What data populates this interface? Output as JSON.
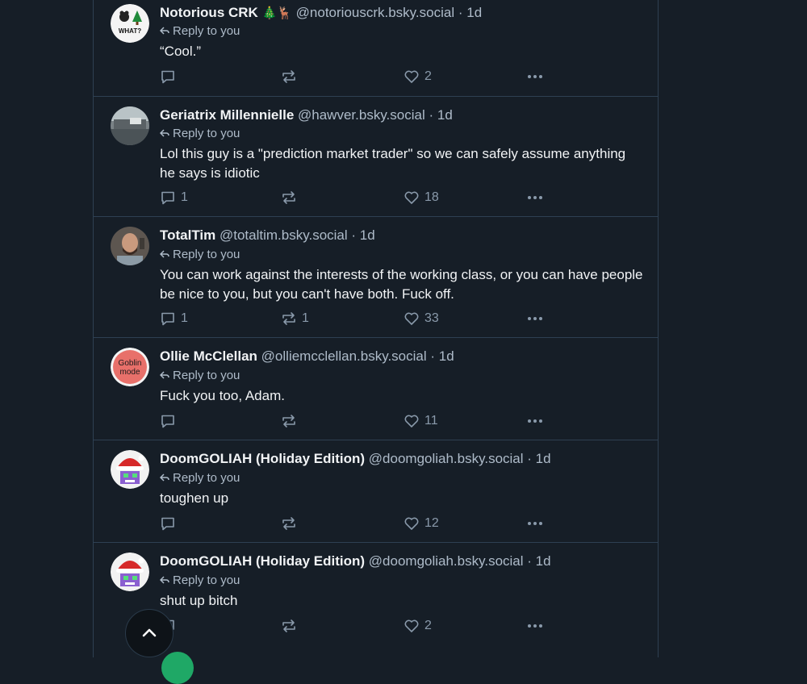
{
  "posts": [
    {
      "name": "Notorious CRK",
      "emoji": "🎄🦌",
      "handle": "@notoriouscrk.bsky.social",
      "time": "1d",
      "reply_label": "Reply to you",
      "text": "“Cool.”",
      "replies": "",
      "reposts": "",
      "likes": "2",
      "avatar": "what-avatar",
      "avatar_text": "WHAT?"
    },
    {
      "name": "Geriatrix Millennielle",
      "emoji": "",
      "handle": "@hawver.bsky.social",
      "time": "1d",
      "reply_label": "Reply to you",
      "text": "Lol this guy is a \"prediction market trader\" so we can safely assume anything he says is idiotic",
      "replies": "1",
      "reposts": "",
      "likes": "18",
      "avatar": "photo-avatar"
    },
    {
      "name": "TotalTim",
      "emoji": "",
      "handle": "@totaltim.bsky.social",
      "time": "1d",
      "reply_label": "Reply to you",
      "text": "You can work against the interests of the working class, or you can have people be nice to you, but you can't have both. Fuck off.",
      "replies": "1",
      "reposts": "1",
      "likes": "33",
      "avatar": "person-avatar"
    },
    {
      "name": "Ollie McClellan",
      "emoji": "",
      "handle": "@olliemcclellan.bsky.social",
      "time": "1d",
      "reply_label": "Reply to you",
      "text": "Fuck you too, Adam.",
      "replies": "",
      "reposts": "",
      "likes": "11",
      "avatar": "goblin-avatar",
      "avatar_text": "Goblin mode"
    },
    {
      "name": "DoomGOLIAH (Holiday Edition)",
      "emoji": "",
      "handle": "@doomgoliah.bsky.social",
      "time": "1d",
      "reply_label": "Reply to you",
      "text": "toughen up",
      "replies": "",
      "reposts": "",
      "likes": "12",
      "avatar": "santa-avatar"
    },
    {
      "name": "DoomGOLIAH (Holiday Edition)",
      "emoji": "",
      "handle": "@doomgoliah.bsky.social",
      "time": "1d",
      "reply_label": "Reply to you",
      "text": "shut up bitch",
      "replies": "",
      "reposts": "",
      "likes": "2",
      "avatar": "santa-avatar"
    }
  ],
  "colors": {
    "background": "#161e27",
    "border": "#2e4052",
    "muted": "#aebbc9",
    "icon": "#8a9aab"
  },
  "icons": {
    "reply": "speech-bubble-icon",
    "repost": "repost-icon",
    "like": "heart-icon",
    "more": "ellipsis-icon",
    "scroll_top": "chevron-up-icon"
  }
}
